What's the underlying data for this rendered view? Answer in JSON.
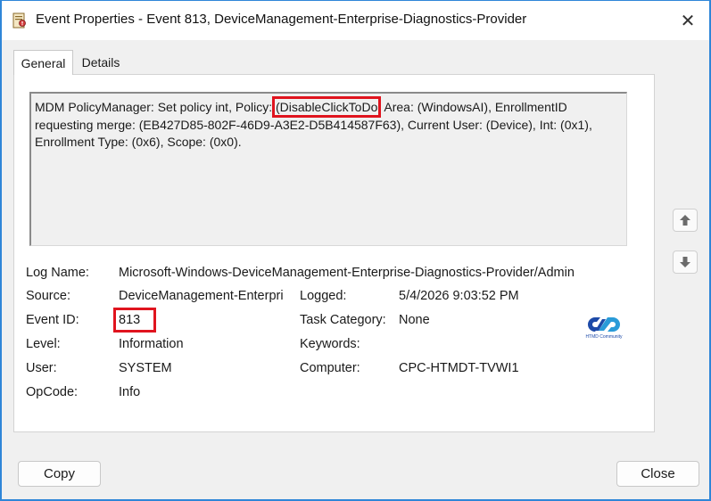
{
  "window": {
    "title": "Event Properties - Event 813, DeviceManagement-Enterprise-Diagnostics-Provider",
    "close_glyph": "✕"
  },
  "tabs": [
    {
      "label": "General",
      "selected": true
    },
    {
      "label": "Details",
      "selected": false
    }
  ],
  "description": {
    "text_before": "MDM PolicyManager: Set policy int, Policy: ",
    "highlighted": "(DisableClickToDo",
    "text_after": ", Area: (WindowsAI), EnrollmentID requesting merge: (EB427D85-802F-46D9-A3E2-D5B414587F63), Current User: (Device), Int: (0x1), Enrollment Type: (0x6), Scope: (0x0).",
    "highlight_color": "#e0141e"
  },
  "fields": {
    "log_name_label": "Log Name:",
    "log_name": "Microsoft-Windows-DeviceManagement-Enterprise-Diagnostics-Provider/Admin",
    "source_label": "Source:",
    "source": "DeviceManagement-Enterpri",
    "logged_label": "Logged:",
    "logged": "5/4/2026 9:03:52 PM",
    "event_id_label": "Event ID:",
    "event_id": "813",
    "task_category_label": "Task Category:",
    "task_category": "None",
    "level_label": "Level:",
    "level": "Information",
    "keywords_label": "Keywords:",
    "keywords": "",
    "user_label": "User:",
    "user": "SYSTEM",
    "computer_label": "Computer:",
    "computer": "CPC-HTMDT-TVWI1",
    "opcode_label": "OpCode:",
    "opcode": "Info"
  },
  "logo": {
    "caption": "HTMD Community",
    "color": "#1d4aa8"
  },
  "buttons": {
    "copy": "Copy",
    "close": "Close"
  },
  "icons": {
    "app": "event-viewer-icon",
    "scroll_up": "arrow-up-icon",
    "scroll_down": "arrow-down-icon",
    "close": "close-icon"
  },
  "colors": {
    "accent_border": "#2f86d8",
    "highlight": "#e0141e"
  }
}
